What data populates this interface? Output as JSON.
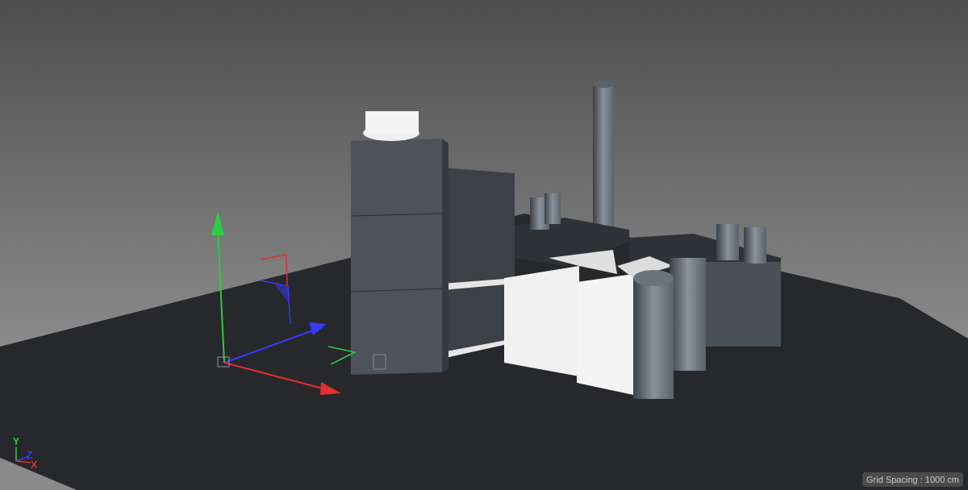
{
  "world_axis_labels": [
    {
      "text": "Y",
      "color": "#2ecc40"
    },
    {
      "text": "Z",
      "color": "#3a3aff"
    },
    {
      "text": "X",
      "color": "#e03030"
    }
  ],
  "status": {
    "grid_spacing": "Grid Spacing : 1000 cm"
  }
}
